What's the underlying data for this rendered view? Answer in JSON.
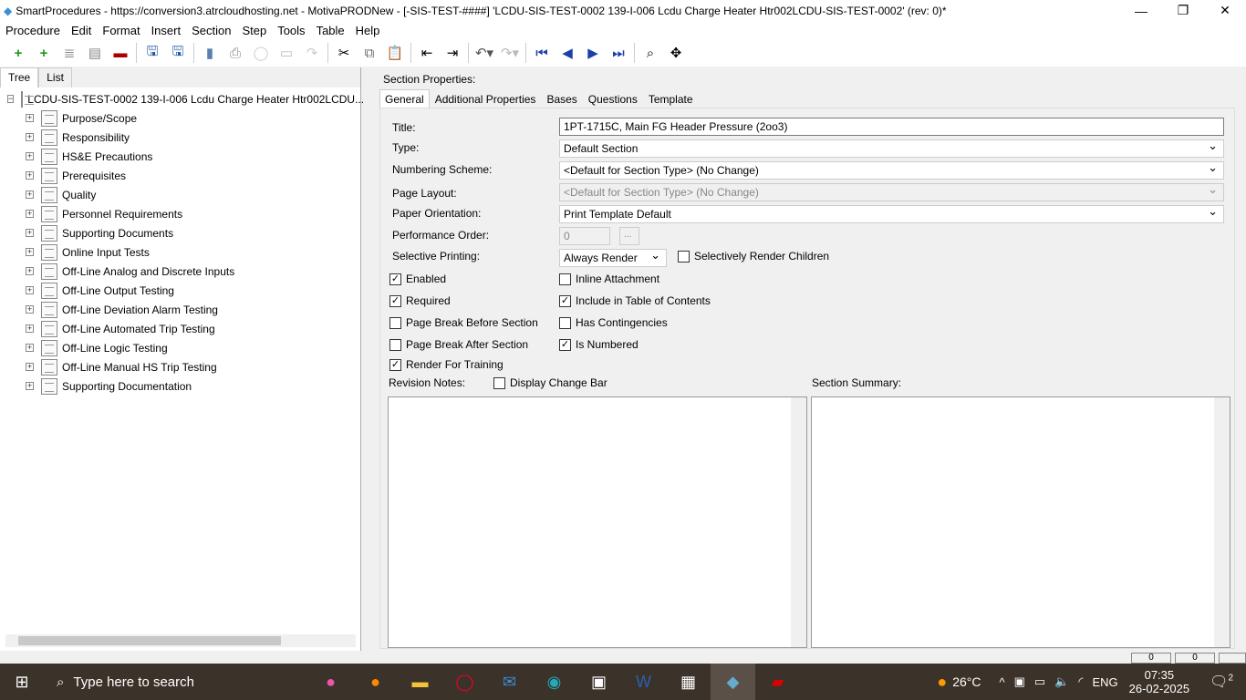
{
  "window": {
    "title": "SmartProcedures - https://conversion3.atrcloudhosting.net - MotivaPRODNew - [-SIS-TEST-####] 'LCDU-SIS-TEST-0002 139-I-006 Lcdu Charge Heater Htr002LCDU-SIS-TEST-0002' (rev: 0)*"
  },
  "menu": [
    "Procedure",
    "Edit",
    "Format",
    "Insert",
    "Section",
    "Step",
    "Tools",
    "Table",
    "Help"
  ],
  "left": {
    "tabs": [
      "Tree",
      "List"
    ],
    "root": "LCDU-SIS-TEST-0002  139-I-006  Lcdu  Charge  Heater  Htr002LCDU...",
    "items": [
      "Purpose/Scope",
      "Responsibility",
      "HS&E Precautions",
      "Prerequisites",
      "Quality",
      "Personnel Requirements",
      "Supporting Documents",
      "Online Input Tests",
      "Off-Line Analog and Discrete Inputs",
      "Off-Line Output Testing",
      "Off-Line Deviation Alarm Testing",
      "Off-Line Automated Trip Testing",
      "Off-Line Logic Testing",
      "Off-Line Manual HS Trip Testing",
      "Supporting Documentation"
    ]
  },
  "right": {
    "heading": "Section Properties:",
    "tabs": [
      "General",
      "Additional Properties",
      "Bases",
      "Questions",
      "Template"
    ],
    "labels": {
      "title": "Title:",
      "type": "Type:",
      "numbering": "Numbering Scheme:",
      "layout": "Page Layout:",
      "orientation": "Paper Orientation:",
      "order": "Performance Order:",
      "selective": "Selective Printing:",
      "revision": "Revision Notes:",
      "summary": "Section Summary:"
    },
    "values": {
      "title": "1PT-1715C, Main FG Header Pressure (2oo3)",
      "type": "Default Section",
      "numbering": "<Default for Section Type> (No Change)",
      "layout": "<Default for Section Type> (No Change)",
      "orientation": "Print Template Default",
      "order": "0",
      "order_btn": "...",
      "selective": "Always Render"
    },
    "checks": {
      "sel_children": {
        "label": "Selectively Render Children",
        "checked": false
      },
      "enabled": {
        "label": "Enabled",
        "checked": true
      },
      "inline": {
        "label": "Inline Attachment",
        "checked": false
      },
      "required": {
        "label": "Required",
        "checked": true
      },
      "toc": {
        "label": "Include in Table of Contents",
        "checked": true
      },
      "pb_before": {
        "label": "Page Break Before Section",
        "checked": false
      },
      "contingencies": {
        "label": "Has Contingencies",
        "checked": false
      },
      "pb_after": {
        "label": "Page Break After Section",
        "checked": false
      },
      "numbered": {
        "label": "Is Numbered",
        "checked": true
      },
      "training": {
        "label": "Render For Training",
        "checked": true
      },
      "change_bar": {
        "label": "Display Change Bar",
        "checked": false
      }
    }
  },
  "status": [
    "0",
    "0"
  ],
  "taskbar": {
    "search": "Type here to search",
    "weather": "26°C",
    "lang": "ENG",
    "time": "07:35",
    "date": "26-02-2025",
    "notifications": "2"
  }
}
